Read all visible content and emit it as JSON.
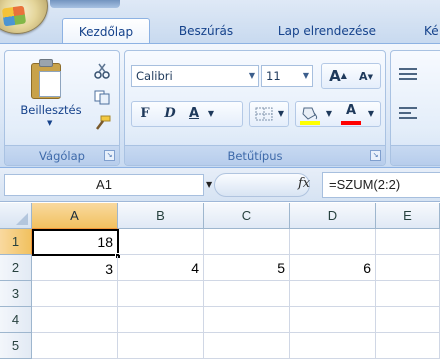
{
  "ribbon": {
    "tabs": [
      {
        "label": "Kezdőlap",
        "active": true
      },
      {
        "label": "Beszúrás",
        "active": false
      },
      {
        "label": "Lap elrendezése",
        "active": false
      },
      {
        "label": "Ké",
        "active": false
      }
    ],
    "clipboard": {
      "paste_label": "Beillesztés",
      "group_label": "Vágólap"
    },
    "font": {
      "font_name": "Calibri",
      "font_size": "11",
      "bold": "F",
      "italic": "D",
      "underline": "A",
      "font_color_glyph": "A",
      "grow_glyph": "A",
      "shrink_glyph": "A",
      "group_label": "Betűtípus",
      "fill_color": "#ffff00",
      "font_color": "#ff0000"
    }
  },
  "formula_bar": {
    "name_box": "A1",
    "fx_label": "fx",
    "formula": "=SZUM(2:2)"
  },
  "grid": {
    "columns": [
      "A",
      "B",
      "C",
      "D",
      "E"
    ],
    "rows": [
      "1",
      "2",
      "3",
      "4",
      "5"
    ],
    "active_cell": "A1",
    "cells": {
      "A1": "18",
      "A2": "3",
      "B2": "4",
      "C2": "5",
      "D2": "6"
    }
  }
}
